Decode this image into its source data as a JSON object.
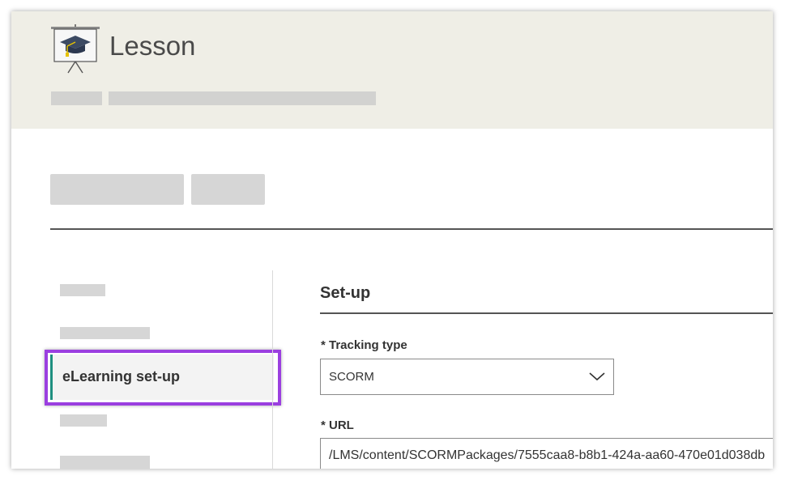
{
  "header": {
    "title": "Lesson",
    "icon": "lesson-presentation-icon"
  },
  "sidebar": {
    "active_item": {
      "label": "eLearning set-up"
    }
  },
  "colors": {
    "header_bg": "#efeee6",
    "active_marker": "#1f8f80",
    "highlight": "#9b3fe0"
  },
  "setup": {
    "title": "Set-up",
    "tracking_type": {
      "label": "* Tracking type",
      "value": "SCORM"
    },
    "url": {
      "label": "* URL",
      "value": "/LMS/content/SCORMPackages/7555caa8-b8b1-424a-aa60-470e01d038db"
    }
  }
}
